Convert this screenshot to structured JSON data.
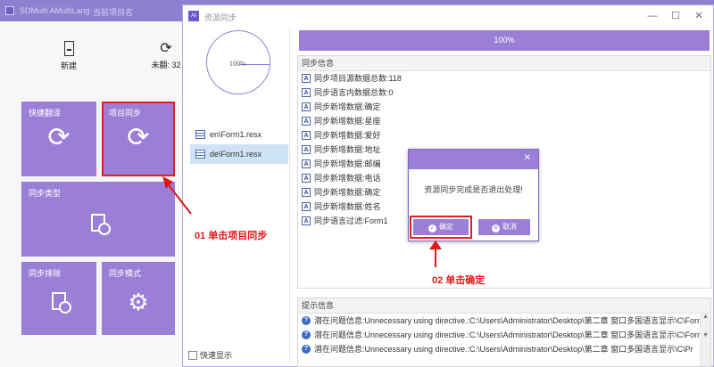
{
  "main": {
    "title_left": "SDMulti AMultiLang",
    "title_right": "当前项目名",
    "toolbar": {
      "new_label": "新建",
      "untranslated_label": "未翻: 32"
    },
    "tiles": {
      "quick_translate": "快捷翻译",
      "project_sync": "项目同步",
      "sync_type": "同步类型",
      "sync_exclude": "同步排除",
      "sync_mode": "同步模式"
    }
  },
  "sync_window": {
    "logo_text": "AI",
    "title": "资源同步",
    "progress_circle_text": "100%",
    "progress_bar_text": "100%",
    "progress_fraction": 1.0,
    "files": [
      "en\\Form1.resx",
      "de\\Form1.resx"
    ],
    "fast_show_label": "快速显示",
    "sync_info_header": "同步信息",
    "sync_log": [
      "同步项目源数据总数:118",
      "同步语言内数据总数:0",
      "同步新增数据:确定",
      "同步新增数据:星座",
      "同步新增数据:爱好",
      "同步新增数据:地址",
      "同步新增数据:邮编",
      "同步新增数据:电话",
      "同步新增数据:确定",
      "同步新增数据:姓名",
      "同步语言过滤:Form1"
    ],
    "hint_header": "提示信息",
    "hints": [
      "潜在问题信息:Unnecessary using directive.:C:\\Users\\Administrator\\Desktop\\第二章 窗口多国语言显示\\C\\Form",
      "潜在问题信息:Unnecessary using directive.:C:\\Users\\Administrator\\Desktop\\第二章 窗口多国语言显示\\C\\Form",
      "潜在问题信息:Unnecessary using directive.:C:\\Users\\Administrator\\Desktop\\第二章 窗口多国语言显示\\C\\Pr"
    ]
  },
  "dialog": {
    "message": "资源同步完成是否退出处理!",
    "ok_label": "确定",
    "cancel_label": "取消"
  },
  "annotations": {
    "step1": "01 单击项目同步",
    "step2": "02 单击确定"
  },
  "colors": {
    "accent": "#9b7fd6",
    "highlight": "#e02020",
    "selection": "#cfe3f7"
  }
}
